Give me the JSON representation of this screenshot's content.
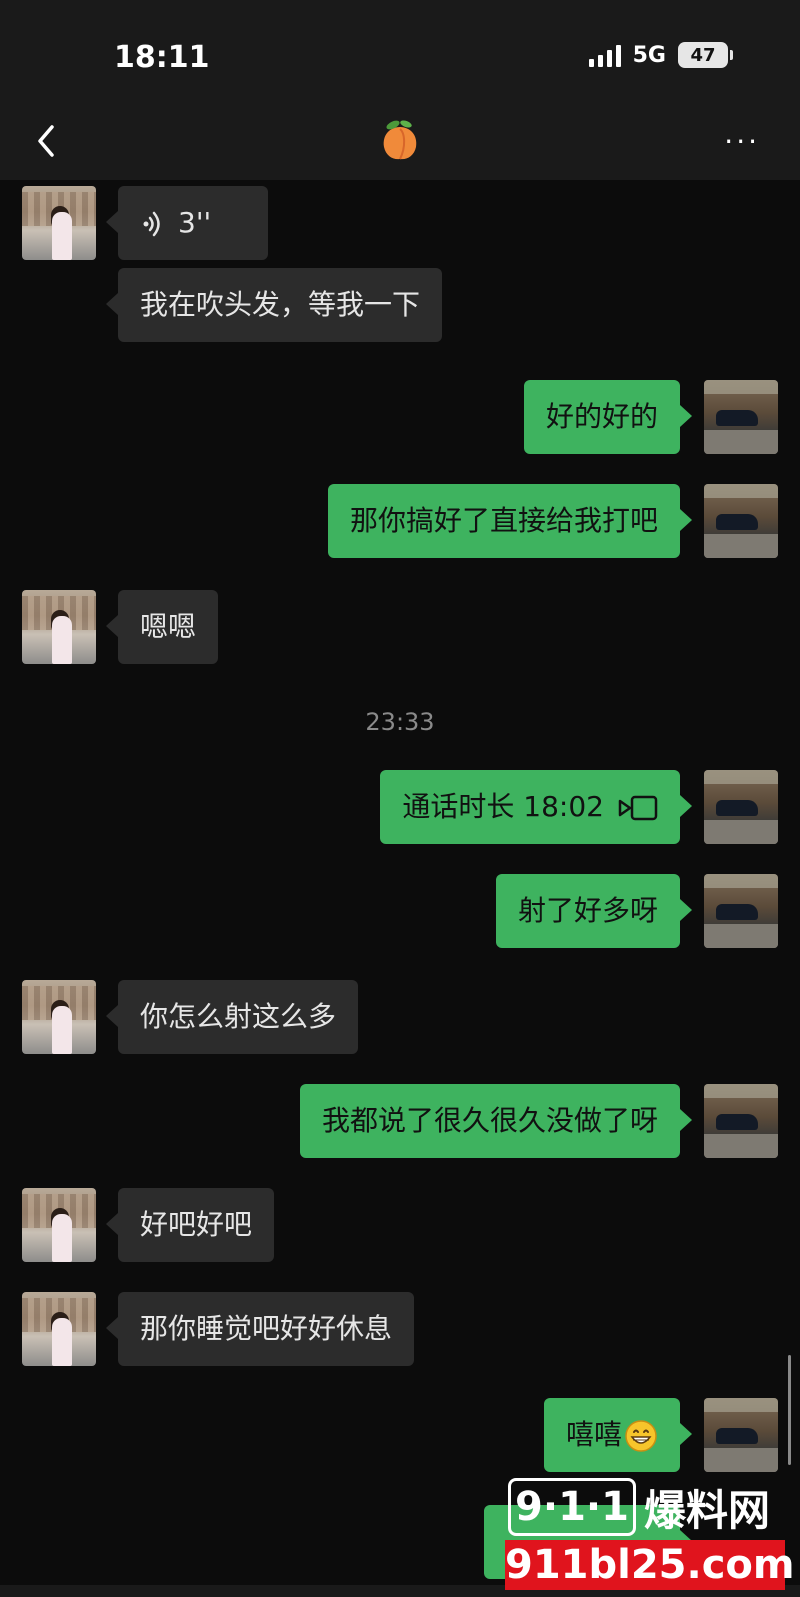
{
  "status_bar": {
    "time": "18:11",
    "network": "5G",
    "battery": "47"
  },
  "nav": {
    "title_icon": "peach-emoji",
    "back_icon": "chevron-left-icon",
    "more_label": "···"
  },
  "messages": [
    {
      "side": "in",
      "type": "voice",
      "text": "3''"
    },
    {
      "side": "in",
      "type": "text",
      "text": "我在吹头发，等我一下"
    },
    {
      "side": "out",
      "type": "text",
      "text": "好的好的"
    },
    {
      "side": "out",
      "type": "text",
      "text": "那你搞好了直接给我打吧"
    },
    {
      "side": "in",
      "type": "text",
      "text": "嗯嗯"
    },
    {
      "side": "out",
      "type": "call",
      "text": "通话时长 18:02"
    },
    {
      "side": "out",
      "type": "text",
      "text": "射了好多呀"
    },
    {
      "side": "in",
      "type": "text",
      "text": "你怎么射这么多"
    },
    {
      "side": "out",
      "type": "text",
      "text": "我都说了很久很久没做了呀"
    },
    {
      "side": "in",
      "type": "text",
      "text": "好吧好吧"
    },
    {
      "side": "in",
      "type": "text",
      "text": "那你睡觉吧好好休息"
    },
    {
      "side": "out",
      "type": "text",
      "text": "嘻嘻",
      "emoji": "grinning-emoji"
    }
  ],
  "timestamp": "23:33",
  "watermark": {
    "brand_box": "9·1·1",
    "brand_text": "爆料网",
    "url": "911bl25.com"
  },
  "colors": {
    "background": "#0c0c0c",
    "bar": "#1a1a1a",
    "incoming_bubble": "#2c2c2c",
    "outgoing_bubble": "#3eb35f",
    "watermark_red": "#e0141d"
  }
}
